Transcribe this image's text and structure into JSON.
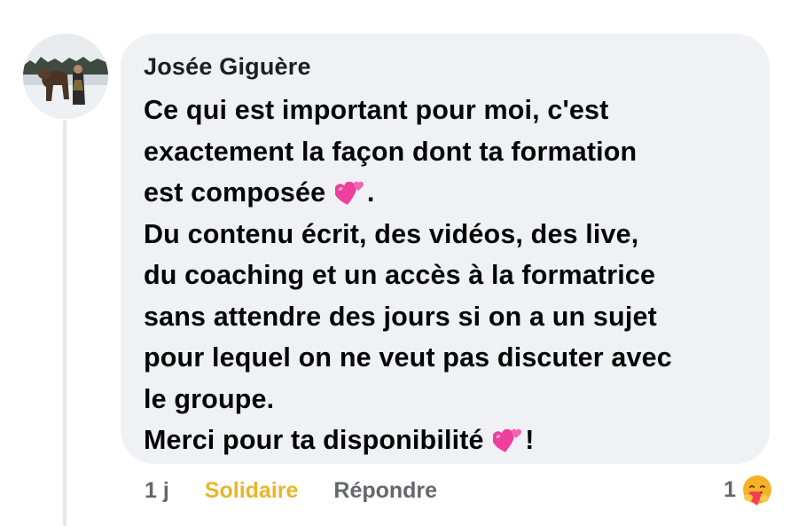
{
  "comment": {
    "author": "Josée Giguère",
    "text_part1": "Ce qui est important pour moi, c'est\nexactement la façon dont ta formation\nest composée",
    "text_part2": ".\nDu contenu écrit, des vidéos, des live,\ndu coaching et un accès à la formatrice\nsans attendre des jours si on a un sujet\npour lequel on ne veut pas discuter avec\nle groupe.\nMerci pour ta disponibilité",
    "text_part3": "!",
    "emoji": "two-hearts-icon"
  },
  "actions": {
    "time": "1 j",
    "react_label": "Solidaire",
    "reply_label": "Répondre",
    "react_color": "#e8b52c"
  },
  "reactions": {
    "count": "1",
    "icon": "care-reaction-icon"
  }
}
